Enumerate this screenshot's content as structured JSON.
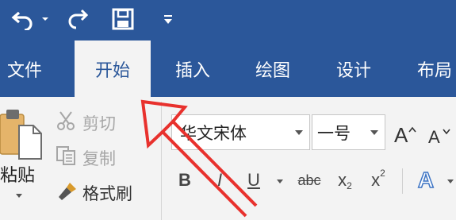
{
  "quick_access": {
    "undo": "undo-icon",
    "redo": "redo-icon",
    "save": "save-icon",
    "customize": "customize-icon"
  },
  "tabs": [
    {
      "label": "文件",
      "active": false
    },
    {
      "label": "开始",
      "active": true
    },
    {
      "label": "插入",
      "active": false
    },
    {
      "label": "绘图",
      "active": false
    },
    {
      "label": "设计",
      "active": false
    },
    {
      "label": "布局",
      "active": false
    }
  ],
  "clipboard": {
    "paste_label": "粘贴",
    "cut_label": "剪切",
    "copy_label": "复制",
    "format_painter_label": "格式刷"
  },
  "font": {
    "family": "华文宋体",
    "size": "一号",
    "grow_label": "A",
    "shrink_label": "A"
  },
  "format": {
    "bold": "B",
    "italic": "I",
    "underline": "U",
    "strike": "abc",
    "subscript": "x",
    "subscript_mark": "2",
    "superscript": "x",
    "superscript_mark": "2",
    "text_effects": "A"
  },
  "colors": {
    "title_bar": "#2b579a",
    "ribbon_bg": "#f3f3f3",
    "annotation_arrow": "#e8312d"
  }
}
